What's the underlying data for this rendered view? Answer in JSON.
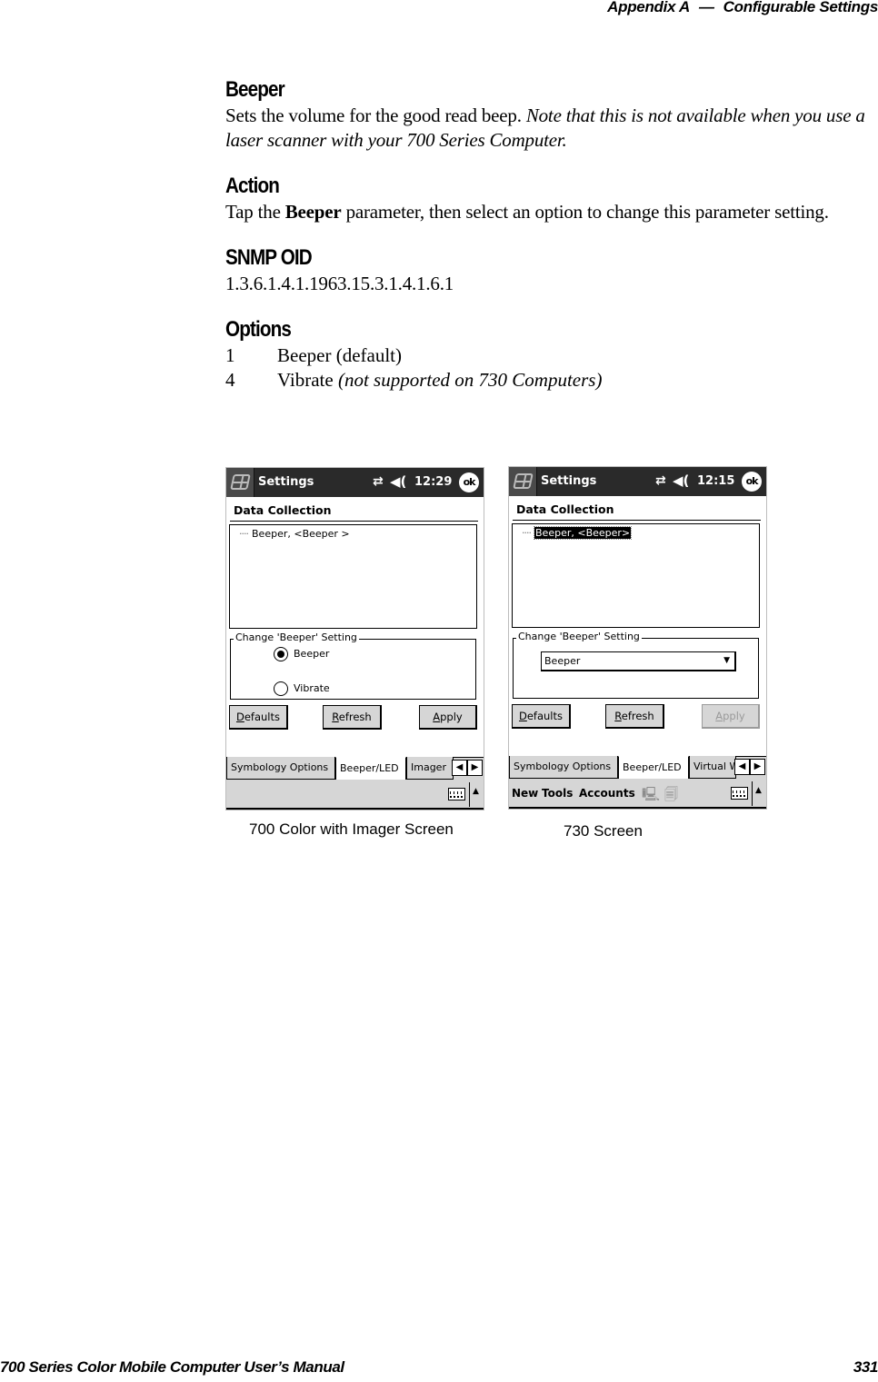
{
  "header": {
    "chapter": "Appendix A",
    "separator": "—",
    "title": "Configurable Settings"
  },
  "footer": {
    "manual_title": "700 Series Color Mobile Computer User’s Manual",
    "page_number": "331"
  },
  "sections": {
    "beeper": {
      "heading": "Beeper",
      "text": "Sets the volume for the good read beep. ",
      "note": "Note that this is not available when you use a laser scanner with your 700 Series Computer."
    },
    "action": {
      "heading": "Action",
      "text_before": "Tap the ",
      "bold": "Beeper",
      "text_after": " parameter, then select an option to change this parameter setting."
    },
    "snmp": {
      "heading": "SNMP OID",
      "oid": "1.3.6.1.4.1.1963.15.3.1.4.1.6.1"
    },
    "options": {
      "heading": "Options",
      "items": [
        {
          "value": "1",
          "label": "Beeper (default)",
          "note": ""
        },
        {
          "value": "4",
          "label": "Vibrate ",
          "note": "(not supported on 730 Computers)"
        }
      ]
    }
  },
  "screens": [
    {
      "caption": "700 Color with Imager Screen",
      "titlebar": {
        "title": "Settings",
        "connectivity_icon": "⇄",
        "volume_icon": "◀(",
        "time": "12:29",
        "ok_label": "ok"
      },
      "pane_title": "Data Collection",
      "tree_item": {
        "dots": "····",
        "label": "Beeper, <Beeper >",
        "selected": false
      },
      "group_label": "Change 'Beeper' Setting",
      "radios": [
        {
          "label": "Beeper",
          "checked": true
        },
        {
          "label": "Vibrate",
          "checked": false
        }
      ],
      "buttons": [
        {
          "mnemonic": "D",
          "rest": "efaults",
          "disabled": false
        },
        {
          "mnemonic": "R",
          "rest": "efresh",
          "disabled": false
        },
        {
          "mnemonic": "A",
          "rest": "pply",
          "disabled": false
        }
      ],
      "tabs": [
        {
          "label": "Symbology Options",
          "active": false
        },
        {
          "label": "Beeper/LED",
          "active": true
        },
        {
          "label": "Imager",
          "active": false
        }
      ],
      "tab_scroll": {
        "left": "◀",
        "right": "▶"
      },
      "menubar": {
        "items": [],
        "sip_arrow": "▲"
      }
    },
    {
      "caption": "730 Screen",
      "titlebar": {
        "title": "Settings",
        "connectivity_icon": "⇄",
        "volume_icon": "◀(",
        "time": "12:15",
        "ok_label": "ok"
      },
      "pane_title": "Data Collection",
      "tree_item": {
        "dots": "····",
        "label": "Beeper, <Beeper>",
        "selected": true
      },
      "group_label": "Change 'Beeper' Setting",
      "combo": {
        "value": "Beeper",
        "arrow": "▼"
      },
      "buttons": [
        {
          "mnemonic": "D",
          "rest": "efaults",
          "disabled": false
        },
        {
          "mnemonic": "R",
          "rest": "efresh",
          "disabled": false
        },
        {
          "mnemonic": "A",
          "rest": "pply",
          "disabled": true
        }
      ],
      "tabs": [
        {
          "label": "Symbology Options",
          "active": false
        },
        {
          "label": "Beeper/LED",
          "active": true
        },
        {
          "label": "Virtual W",
          "active": false
        }
      ],
      "tab_scroll": {
        "left": "◀",
        "right": "▶"
      },
      "menubar": {
        "items": [
          "New",
          "Tools",
          "Accounts"
        ],
        "icons": [
          "🖳",
          "🗐"
        ],
        "sip_arrow": "▲"
      }
    }
  ]
}
